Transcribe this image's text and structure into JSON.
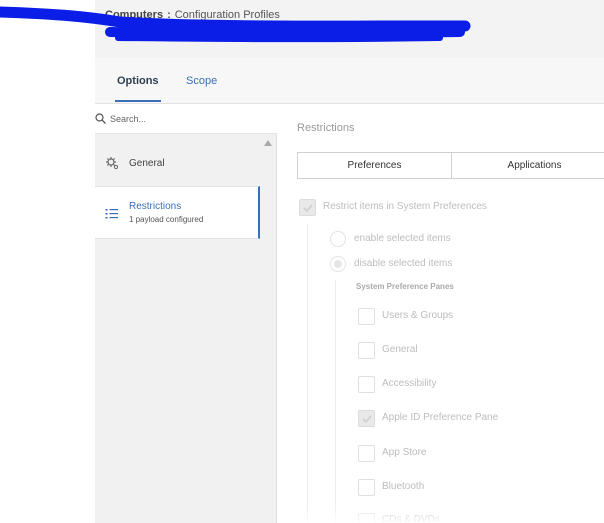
{
  "header": {
    "breadcrumb_root": "Computers",
    "breadcrumb_separator": ":",
    "breadcrumb_current": "Configuration Profiles",
    "redaction_color": "#0a1ee8"
  },
  "tabs": [
    {
      "label": "Options",
      "active": true
    },
    {
      "label": "Scope",
      "active": false
    }
  ],
  "sidebar": {
    "search_placeholder": "Search...",
    "items": [
      {
        "title": "General",
        "subtitle": "",
        "icon": "gear-icon",
        "selected": false
      },
      {
        "title": "Restrictions",
        "subtitle": "1 payload configured",
        "icon": "list-icon",
        "selected": true
      }
    ]
  },
  "main": {
    "section_title": "Restrictions",
    "segments": [
      "Preferences",
      "Applications"
    ],
    "restrict_label": "Restrict items in System Preferences",
    "restrict_checked": true,
    "radio_options": [
      {
        "label": "enable selected items",
        "selected": false
      },
      {
        "label": "disable selected items",
        "selected": true
      }
    ],
    "panes_heading": "System Preference Panes",
    "panes": [
      {
        "label": "Users & Groups",
        "checked": false
      },
      {
        "label": "General",
        "checked": false
      },
      {
        "label": "Accessibility",
        "checked": false
      },
      {
        "label": "Apple ID Preference Pane",
        "checked": true
      },
      {
        "label": "App Store",
        "checked": false
      },
      {
        "label": "Bluetooth",
        "checked": false
      },
      {
        "label": "CDs & DVDs",
        "checked": false
      }
    ]
  },
  "colors": {
    "accent": "#3b6fb6",
    "header_bg": "#f3f3f4",
    "sidebar_bg": "#f1f1f2",
    "disabled_text": "#bdbdbd"
  }
}
